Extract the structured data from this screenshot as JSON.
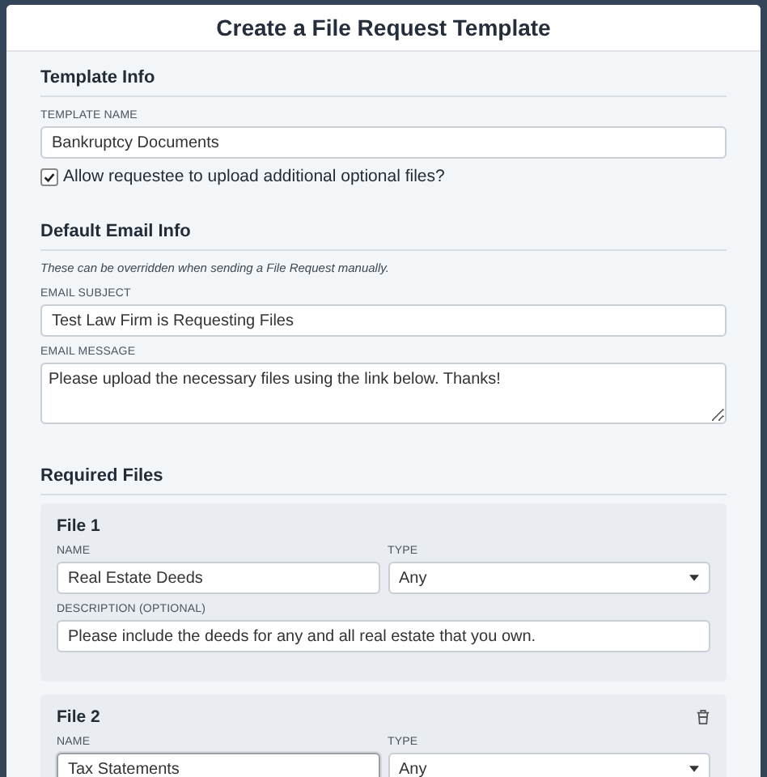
{
  "modal": {
    "title": "Create a File Request Template"
  },
  "template_info": {
    "heading": "Template Info",
    "name_field": {
      "label": "TEMPLATE NAME",
      "value": "Bankruptcy Documents"
    },
    "checkbox": {
      "label": "Allow requestee to upload additional optional files?",
      "checked": true
    }
  },
  "default_email_info": {
    "heading": "Default Email Info",
    "note": "These can be overridden when sending a File Request manually.",
    "subject": {
      "label": "EMAIL SUBJECT",
      "value": "Test Law Firm is Requesting Files"
    },
    "message": {
      "label": "EMAIL MESSAGE",
      "value": "Please upload the necessary files using the link below. Thanks!"
    }
  },
  "required_files": {
    "heading": "Required Files",
    "files": [
      {
        "title": "File 1",
        "removable": false,
        "name": {
          "label": "NAME",
          "value": "Real Estate Deeds",
          "focused": false
        },
        "type": {
          "label": "TYPE",
          "value": "Any"
        },
        "description": {
          "label": "DESCRIPTION (OPTIONAL)",
          "value": "Please include the deeds for any and all real estate that you own."
        }
      },
      {
        "title": "File 2",
        "removable": true,
        "name": {
          "label": "NAME",
          "value": "Tax Statements",
          "focused": true
        },
        "type": {
          "label": "TYPE",
          "value": "Any"
        }
      }
    ]
  }
}
